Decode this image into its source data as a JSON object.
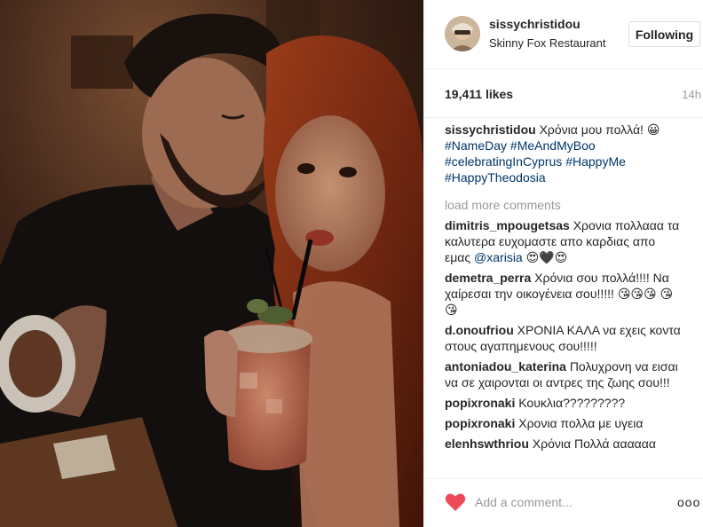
{
  "post": {
    "author": "sissychristidou",
    "location": "Skinny Fox Restaurant",
    "follow_label": "Following",
    "likes": "19,411 likes",
    "time_ago": "14h"
  },
  "caption": {
    "user": "sissychristidou",
    "text": "Χρόνια μου πολλά! 😀",
    "hashtags": [
      "#NameDay",
      "#MeAndMyBoo",
      "#celebratingInCyprus",
      "#HappyMe",
      "#HappyTheodosia"
    ]
  },
  "load_more_label": "load more comments",
  "comments": [
    {
      "user": "dimitris_mpougetsas",
      "text": "Χρονια πολλααα τα καλυτερα ευχομαστε απο καρδιας απο εμας ",
      "mention": "@xarisia",
      "after": " 😍🖤😍"
    },
    {
      "user": "demetra_perra",
      "text": "Χρόνια σου πολλά!!!! Να χαίρεσαι την οικογένεια σου!!!!! 😘😘😘 😘😘"
    },
    {
      "user": "d.onoufriou",
      "text": "ΧΡΟΝΙΑ ΚΑΛΑ να εχεις κοντα στους αγαπημενους σου!!!!!"
    },
    {
      "user": "antoniadou_katerina",
      "text": "Πολυχρονη να εισαι να σε χαιρονται οι αντρες της ζωης σου!!!"
    },
    {
      "user": "popixronaki",
      "text": "Κουκλια?????????"
    },
    {
      "user": "popixronaki",
      "text": "Χρονια πολλα με υγεια"
    },
    {
      "user": "elenhswthriou",
      "text": "Χρόνια Πολλά αααααα"
    }
  ],
  "footer": {
    "comment_placeholder": "Add a comment...",
    "more_symbol": "ooo"
  },
  "colors": {
    "text": "#262626",
    "muted": "#999999",
    "link": "#003569",
    "like": "#ed4956",
    "border": "#efefef"
  },
  "icons": {
    "like": "heart-icon",
    "options": "more-options-icon"
  }
}
